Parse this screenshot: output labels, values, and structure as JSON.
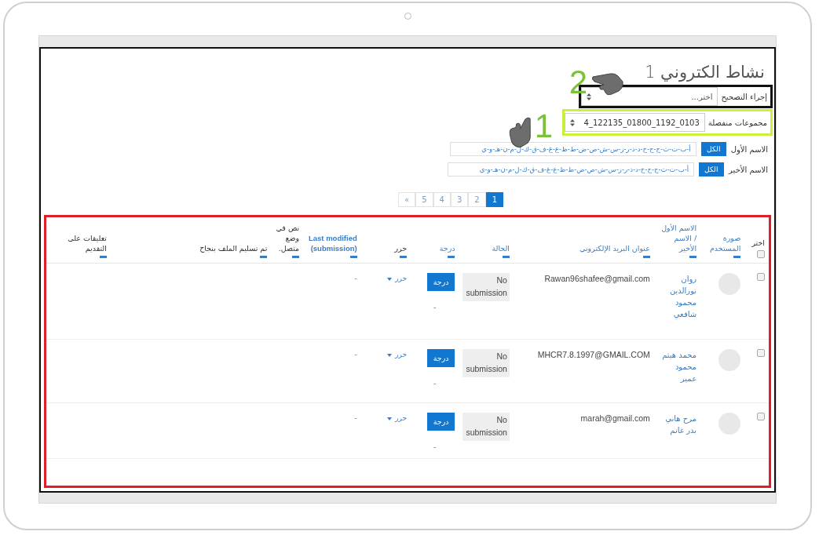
{
  "title": "نشاط الكتروني 1",
  "grading_action": {
    "label": "إجراء التصحيح",
    "value": "اختر..."
  },
  "groups": {
    "label": "مجموعات منفصلة",
    "value": "4_122135_01800_1192_0103"
  },
  "annotations": [
    "2",
    "1"
  ],
  "name_filters": [
    {
      "label": "الاسم الأول",
      "all": "الكل",
      "letters": "أ-ب-ت-ث-ج-ح-خ-د-ذ-ر-ز-س-ش-ص-ض-ط-ظ-ع-غ-ف-ق-ك-ل-م-ن-هـ-و-ي"
    },
    {
      "label": "الاسم الأخير",
      "all": "الكل",
      "letters": "أ-ب-ت-ث-ج-ح-خ-د-ذ-ر-ز-س-ش-ص-ض-ط-ظ-ع-غ-ف-ق-ك-ل-م-ن-هـ-و-ي"
    }
  ],
  "pagination": [
    {
      "label": "1",
      "selected": true
    },
    {
      "label": "2",
      "selected": false
    },
    {
      "label": "3",
      "selected": false
    },
    {
      "label": "4",
      "selected": false
    },
    {
      "label": "5",
      "selected": false
    },
    {
      "label": "»",
      "selected": false
    }
  ],
  "table": {
    "select_all_checked": false,
    "columns": [
      {
        "label": "اختر",
        "kind": "select"
      },
      {
        "label": "صورة المستخدم",
        "kind": "link"
      },
      {
        "label": "الاسم الأول / الاسم الأخير",
        "kind": "link"
      },
      {
        "label": "عنوان البريد الإلكتروني",
        "kind": "link"
      },
      {
        "label": "الحالة",
        "kind": "link"
      },
      {
        "label": "درجة",
        "kind": "link"
      },
      {
        "label": "حرر",
        "kind": "plain"
      },
      {
        "label": "Last modified (submission)",
        "kind": "bold"
      },
      {
        "label": "نص في وضع متصل.",
        "kind": "plain"
      },
      {
        "label": "تم تسليم الملف بنجاح",
        "kind": "plain"
      },
      {
        "label": "تعليقات على التقديم",
        "kind": "plain"
      }
    ],
    "rows": [
      {
        "checked": false,
        "name": "روان نورالدين محمود شافعي",
        "email": "Rawan96shafee@gmail.com",
        "status": "No submission",
        "grade_button": "درجة",
        "grade": "-",
        "edit": "حرر",
        "last_modified": "-"
      },
      {
        "checked": false,
        "name": "محمد هيثم محمود عمير",
        "email": "MHCR7.8.1997@GMAIL.COM",
        "status": "No submission",
        "grade_button": "درجة",
        "grade": "-",
        "edit": "حرر",
        "last_modified": "-"
      },
      {
        "checked": false,
        "name": "مرح هاني بدر غانم",
        "email": "marah@gmail.com",
        "status": "No submission",
        "grade_button": "درجة",
        "grade": "-",
        "edit": "حرر",
        "last_modified": "-"
      }
    ]
  }
}
